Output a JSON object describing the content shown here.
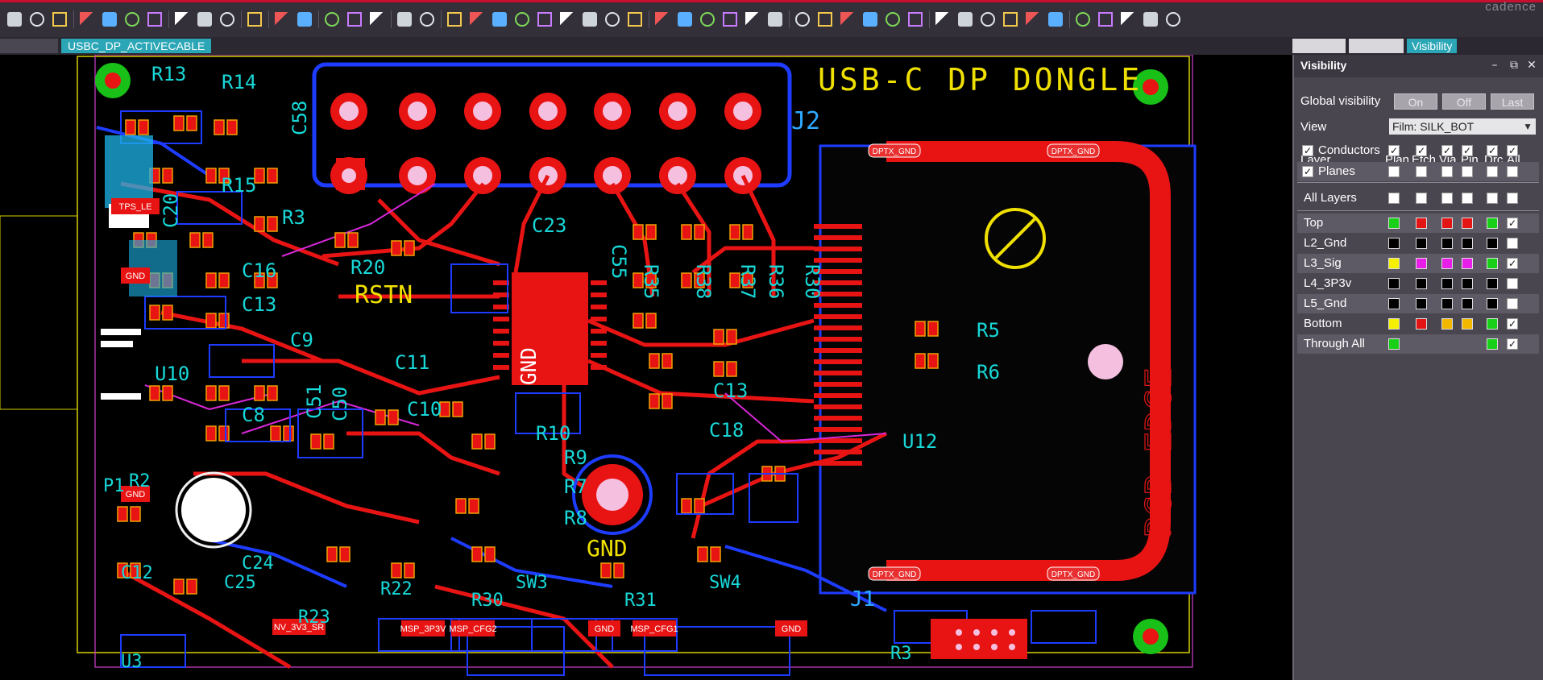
{
  "app": {
    "brand": "cadence"
  },
  "design_tab": "USBC_DP_ACTIVECABLE",
  "toolbar": {
    "icons": [
      "new-file",
      "open-folder",
      "save",
      "move",
      "copy",
      "delete",
      "undo",
      "redo",
      "pin",
      "unpin",
      "add-line",
      "text-edit",
      "text-edit2",
      "chip",
      "spline",
      "grab-hand",
      "swap",
      "circle-red",
      "zoom-fit",
      "zoom-prev",
      "zoom-in",
      "zoom-out",
      "zoom-world",
      "zoom-center",
      "refresh",
      "shape",
      "grid",
      "color-wheel",
      "layer-swap",
      "layer-stack",
      "report",
      "settings",
      "visibility-eye",
      "visibility-doc",
      "3d-view",
      "shading",
      "highlight",
      "dehighlight",
      "add-shape",
      "window",
      "cloud",
      "x-box",
      "slash-box",
      "constraint",
      "fx",
      "sync",
      "image",
      "board",
      "multi-layer",
      "share"
    ]
  },
  "panel": {
    "tabs": [
      "",
      "",
      "Visibility"
    ],
    "title": "Visibility",
    "global_visibility_label": "Global visibility",
    "global_buttons": [
      "On",
      "Off",
      "Last"
    ],
    "view_label": "View",
    "view_value": "Film: SILK_BOT",
    "columns": [
      "Layer",
      "Plan",
      "Etch",
      "Via",
      "Pin",
      "Drc",
      "All"
    ],
    "groups": [
      {
        "name": "Conductors",
        "checked": true,
        "cells": [
          "ck",
          "ck",
          "ck",
          "ck",
          "ck",
          "ck"
        ]
      },
      {
        "name": "Planes",
        "checked": true,
        "cells": [
          "empty",
          "empty",
          "empty",
          "empty",
          "empty",
          "empty"
        ]
      }
    ],
    "all_layers_label": "All Layers",
    "layers": [
      {
        "name": "Top",
        "cells": [
          "#18d018",
          "#e21414",
          "#e21414",
          "#e21414",
          "#18d018",
          "ck"
        ]
      },
      {
        "name": "L2_Gnd",
        "cells": [
          "#000000",
          "#000000",
          "#000000",
          "#000000",
          "#000000",
          "empty"
        ]
      },
      {
        "name": "L3_Sig",
        "cells": [
          "#f5f000",
          "#e81ee8",
          "#e81ee8",
          "#e81ee8",
          "#18d018",
          "ck"
        ]
      },
      {
        "name": "L4_3P3v",
        "cells": [
          "#000000",
          "#000000",
          "#000000",
          "#000000",
          "#000000",
          "empty"
        ]
      },
      {
        "name": "L5_Gnd",
        "cells": [
          "#000000",
          "#000000",
          "#000000",
          "#000000",
          "#000000",
          "empty"
        ]
      },
      {
        "name": "Bottom",
        "cells": [
          "#f5f000",
          "#e21414",
          "#f2b800",
          "#f2b800",
          "#18d018",
          "ck"
        ]
      },
      {
        "name": "Through All",
        "cells": [
          "#18d018",
          "none",
          "none",
          "none",
          "#18d018",
          "ck"
        ]
      }
    ]
  },
  "board": {
    "title": "USB-C DP DONGLE",
    "edge_label": "PCB EDGE",
    "connectors": {
      "header": "J2",
      "usb": "J1"
    },
    "refdes_top": [
      "R13",
      "R14",
      "C58",
      "R15",
      "R3",
      "C20",
      "R20",
      "RSTN",
      "C23",
      "C55",
      "R35",
      "R38",
      "R37",
      "R36",
      "R30",
      "R5",
      "R6",
      "U12"
    ],
    "refdes_mid": [
      "U10",
      "C16",
      "C13",
      "C9",
      "C8",
      "C51",
      "C50",
      "C11",
      "C10",
      "C18",
      "C13",
      "R10",
      "R9",
      "R7",
      "R8",
      "GND"
    ],
    "refdes_bottom": [
      "P1",
      "R2",
      "C12",
      "C24",
      "C25",
      "R22",
      "R23",
      "R30",
      "R31",
      "SW3",
      "SW4",
      "R3",
      "C10",
      "U3"
    ],
    "net_labels": [
      "GND",
      "TPS_LE",
      "NV_3V3_SR",
      "MSP_3P3V",
      "MSP_CFG2",
      "GND",
      "MSP_CFG1",
      "GND",
      "DPTX_GND",
      "DPTX_GND",
      "DPTX_GND",
      "DPTX_GND"
    ],
    "layer_colors": {
      "etch_top": "#e81414",
      "pad_pin": "#f5c0e0",
      "silk": "#f0e000",
      "outline": "#1e3cff",
      "refdes": "#18d8d8",
      "keepout": "#d040d0",
      "pad_mask": "#f0a000"
    }
  }
}
